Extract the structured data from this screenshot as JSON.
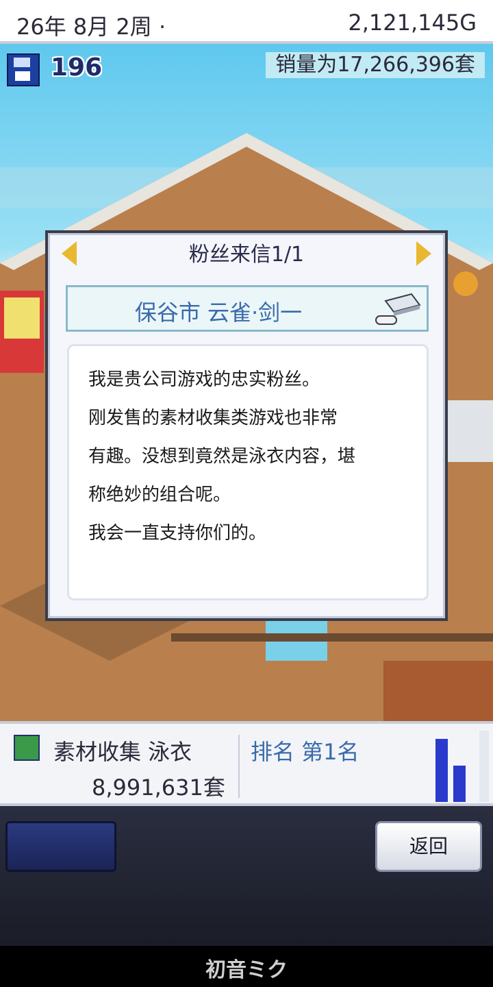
{
  "top_bar": {
    "date": "26年 8月 2周 ·",
    "money": "2,121,145G"
  },
  "hud": {
    "floppy_count": "196",
    "sales_total": "销量为17,266,396套"
  },
  "fan_letter": {
    "title": "粉丝来信1/1",
    "sender": "保谷市 云雀·剑一",
    "lines": [
      "我是贵公司游戏的忠实粉丝。",
      "刚发售的素材收集类游戏也非常",
      "有趣。没想到竟然是泳衣内容，堪",
      "称绝妙的组合呢。",
      "我会一直支持你们的。"
    ]
  },
  "game_info": {
    "name": "素材收集  泳衣",
    "sales": "8,991,631套",
    "rank": "排名 第1名",
    "bar_levels": [
      0.96,
      0.55
    ]
  },
  "buttons": {
    "back": "返回"
  },
  "footer": {
    "logo": "初音ミク"
  },
  "colors": {
    "accent_blue": "#3a6aaa",
    "arrow_gold": "#e8b830"
  }
}
